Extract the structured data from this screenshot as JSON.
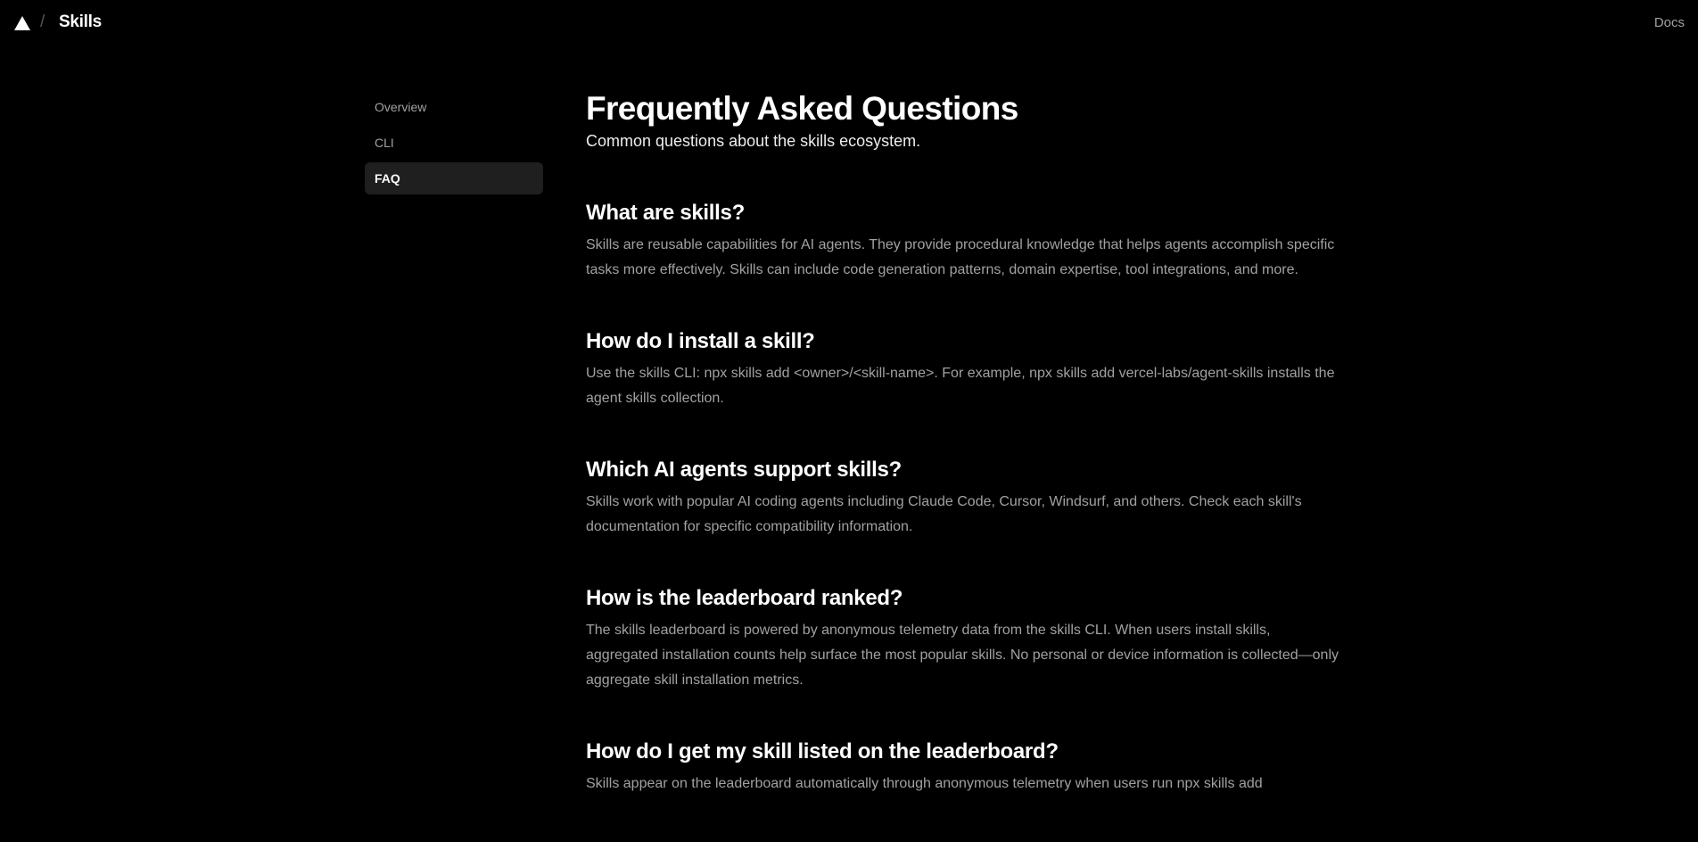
{
  "header": {
    "brand": "Skills",
    "separator": "/",
    "docs_label": "Docs",
    "logo_icon": "triangle-logo-icon"
  },
  "sidebar": {
    "items": [
      {
        "label": "Overview",
        "active": false
      },
      {
        "label": "CLI",
        "active": false
      },
      {
        "label": "FAQ",
        "active": true
      }
    ]
  },
  "main": {
    "title": "Frequently Asked Questions",
    "subtitle": "Common questions about the skills ecosystem.",
    "faq": [
      {
        "question": "What are skills?",
        "answer": "Skills are reusable capabilities for AI agents. They provide procedural knowledge that helps agents accomplish specific tasks more effectively. Skills can include code generation patterns, domain expertise, tool integrations, and more."
      },
      {
        "question": "How do I install a skill?",
        "answer": "Use the skills CLI: npx skills add <owner>/<skill-name>. For example, npx skills add vercel-labs/agent-skills installs the agent skills collection."
      },
      {
        "question": "Which AI agents support skills?",
        "answer": "Skills work with popular AI coding agents including Claude Code, Cursor, Windsurf, and others. Check each skill's documentation for specific compatibility information."
      },
      {
        "question": "How is the leaderboard ranked?",
        "answer": "The skills leaderboard is powered by anonymous telemetry data from the skills CLI. When users install skills, aggregated installation counts help surface the most popular skills. No personal or device information is collected—only aggregate skill installation metrics."
      },
      {
        "question": "How do I get my skill listed on the leaderboard?",
        "answer": "Skills appear on the leaderboard automatically through anonymous telemetry when users run npx skills add"
      }
    ]
  },
  "colors": {
    "background": "#000000",
    "active_nav_bg": "#1f1f1f",
    "muted_text": "#a1a1a1",
    "heading_text": "#ffffff"
  }
}
